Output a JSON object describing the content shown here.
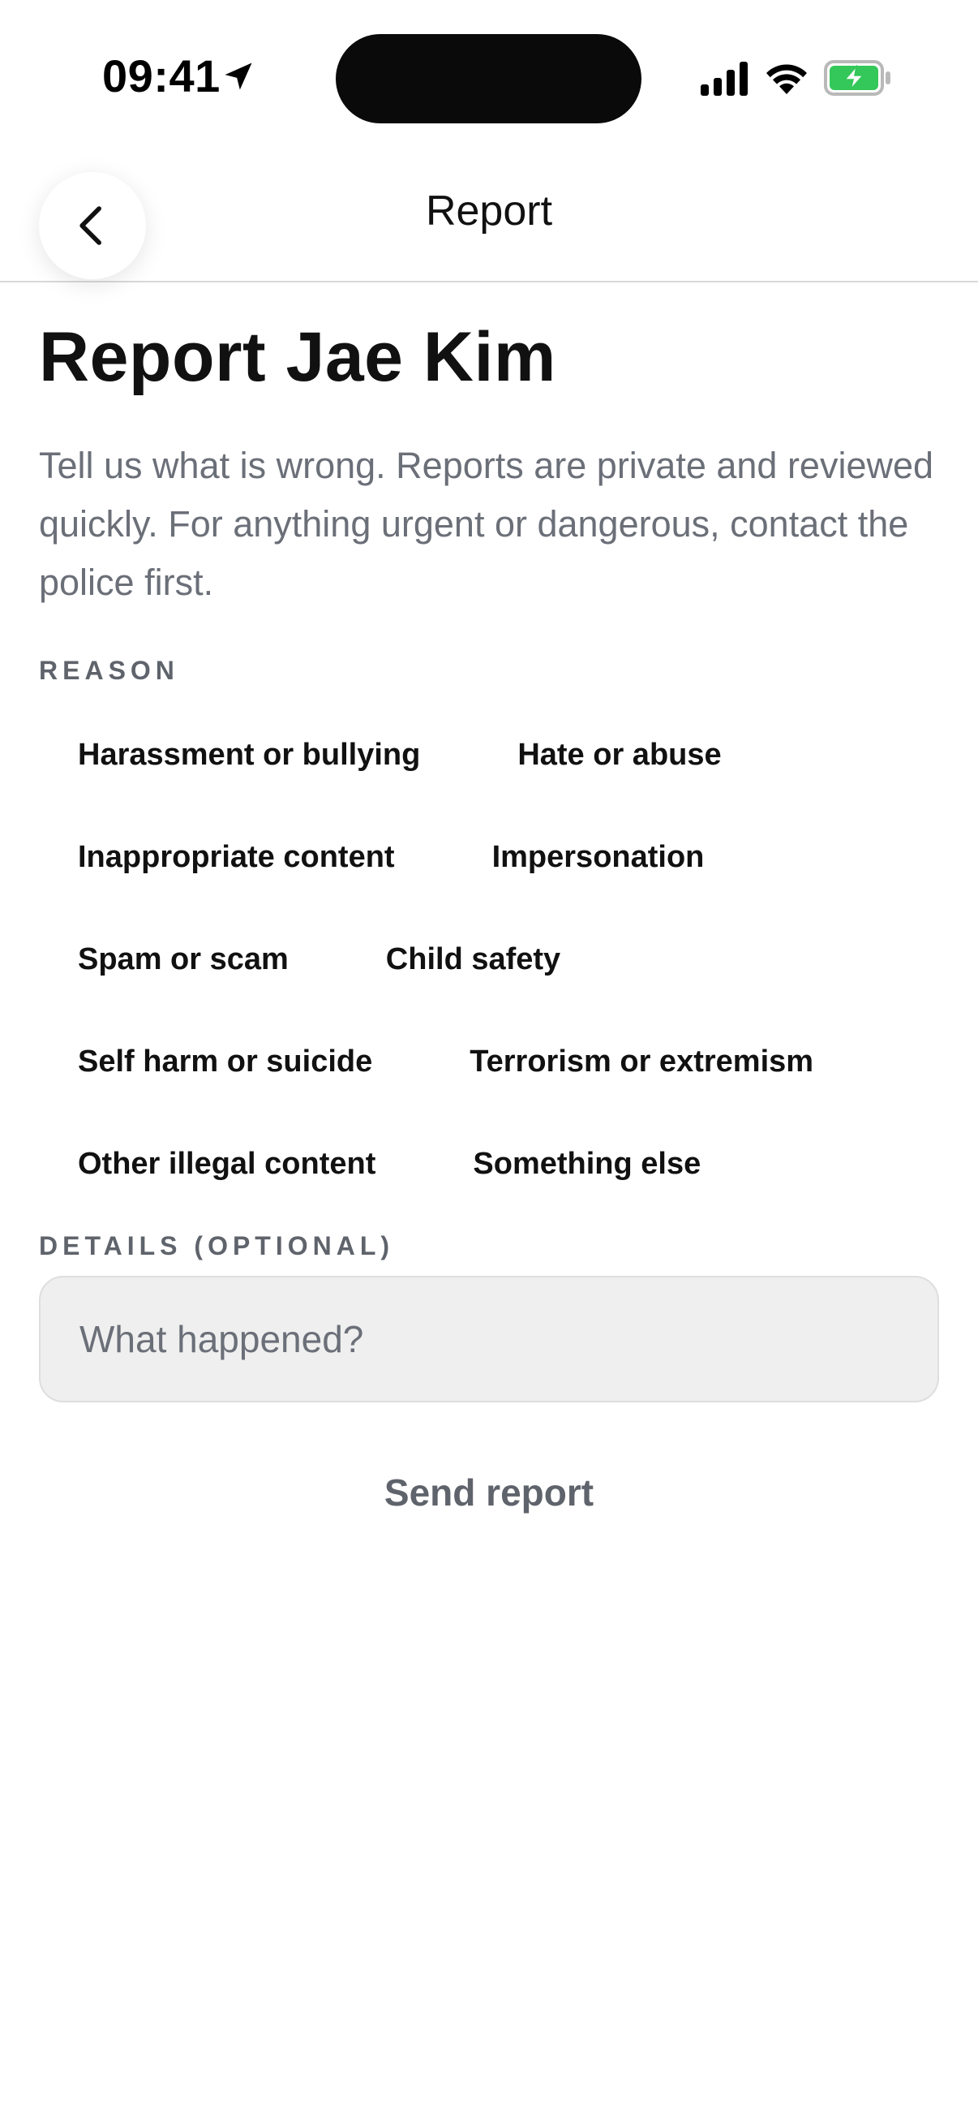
{
  "status_bar": {
    "time": "09:41",
    "icons": [
      "location-arrow-icon",
      "cellular-signal-icon",
      "wifi-icon",
      "battery-charging-icon"
    ],
    "battery_color": "#34c759"
  },
  "header": {
    "title": "Report",
    "back_icon": "chevron-left-icon"
  },
  "main": {
    "title": "Report Jae Kim",
    "intro": "Tell us what is wrong. Reports are private and reviewed quickly. For anything urgent or dangerous, contact the police first.",
    "reason_label": "REASON",
    "reasons": [
      "Harassment or bullying",
      "Hate or abuse",
      "Inappropriate content",
      "Impersonation",
      "Spam or scam",
      "Child safety",
      "Self harm or suicide",
      "Terrorism or extremism",
      "Other illegal content",
      "Something else"
    ],
    "details_label": "DETAILS (OPTIONAL)",
    "details_placeholder": "What happened?",
    "details_value": "",
    "send_label": "Send report"
  },
  "colors": {
    "text_primary": "#111111",
    "text_secondary": "#6b6f78",
    "input_background": "#efefef",
    "divider": "#d9d9d9"
  }
}
